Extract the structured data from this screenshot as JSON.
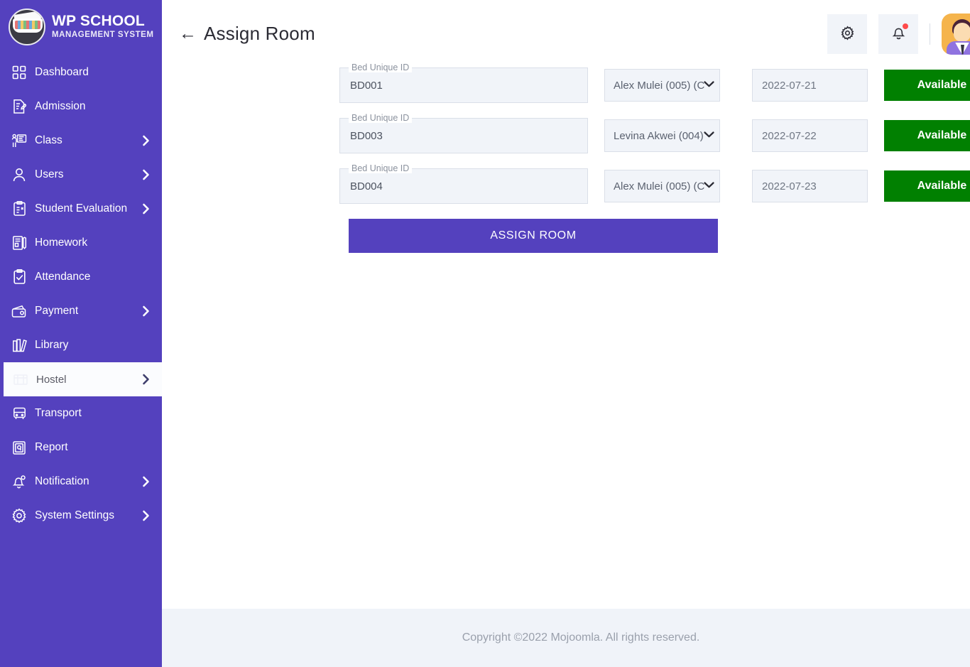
{
  "brand": {
    "title": "WP SCHOOL",
    "subtitle": "MANAGEMENT SYSTEM",
    "logo_icon": "graduation-cap-logo-icon"
  },
  "sidebar": {
    "items": [
      {
        "label": "Dashboard",
        "icon": "grid-dashboard-icon",
        "has_chevron": false,
        "active": false,
        "sub": false
      },
      {
        "label": "Admission",
        "icon": "document-pencil-icon",
        "has_chevron": false,
        "active": false,
        "sub": false
      },
      {
        "label": "Class",
        "icon": "teacher-board-icon",
        "has_chevron": true,
        "active": false,
        "sub": false
      },
      {
        "label": "Users",
        "icon": "person-icon",
        "has_chevron": true,
        "active": false,
        "sub": false
      },
      {
        "label": "Student Evaluation",
        "icon": "clipboard-check-icon",
        "has_chevron": true,
        "active": false,
        "sub": false
      },
      {
        "label": "Homework",
        "icon": "notebook-pen-icon",
        "has_chevron": false,
        "active": false,
        "sub": false
      },
      {
        "label": "Attendance",
        "icon": "clipboard-tick-icon",
        "has_chevron": false,
        "active": false,
        "sub": false
      },
      {
        "label": "Payment",
        "icon": "wallet-icon",
        "has_chevron": true,
        "active": false,
        "sub": false
      },
      {
        "label": "Library",
        "icon": "books-icon",
        "has_chevron": false,
        "active": false,
        "sub": false
      },
      {
        "label": "Hostel",
        "icon": "hostel-building-icon",
        "has_chevron": true,
        "active": true,
        "sub": true
      },
      {
        "label": "Transport",
        "icon": "bus-icon",
        "has_chevron": false,
        "active": false,
        "sub": false
      },
      {
        "label": "Report",
        "icon": "report-document-icon",
        "has_chevron": false,
        "active": false,
        "sub": false
      },
      {
        "label": "Notification",
        "icon": "bell-icon",
        "has_chevron": true,
        "active": false,
        "sub": false
      },
      {
        "label": "System Settings",
        "icon": "gear-icon",
        "has_chevron": true,
        "active": false,
        "sub": false
      }
    ]
  },
  "header": {
    "back_label": "←",
    "title": "Assign Room",
    "settings_icon": "gear-icon",
    "notification_icon": "bell-icon",
    "avatar_icon": "user-avatar"
  },
  "form": {
    "bed_label": "Bed Unique ID",
    "rows": [
      {
        "bed_id": "BD001",
        "student": "Alex Mulei (005) (C",
        "date": "2022-07-21",
        "status": "Available"
      },
      {
        "bed_id": "BD003",
        "student": "Levina Akwei (004)",
        "date": "2022-07-22",
        "status": "Available"
      },
      {
        "bed_id": "BD004",
        "student": "Alex Mulei (005) (C",
        "date": "2022-07-23",
        "status": "Available"
      }
    ],
    "submit_label": "ASSIGN ROOM"
  },
  "footer": {
    "copyright": "Copyright ©2022 Mojoomla. All rights reserved."
  },
  "colors": {
    "sidebar_purple": "#5441BE",
    "status_green": "#018001",
    "field_bg": "#f1f4f9",
    "footer_bg": "#f0f3f9",
    "avatar_orange": "#f5b44c"
  }
}
